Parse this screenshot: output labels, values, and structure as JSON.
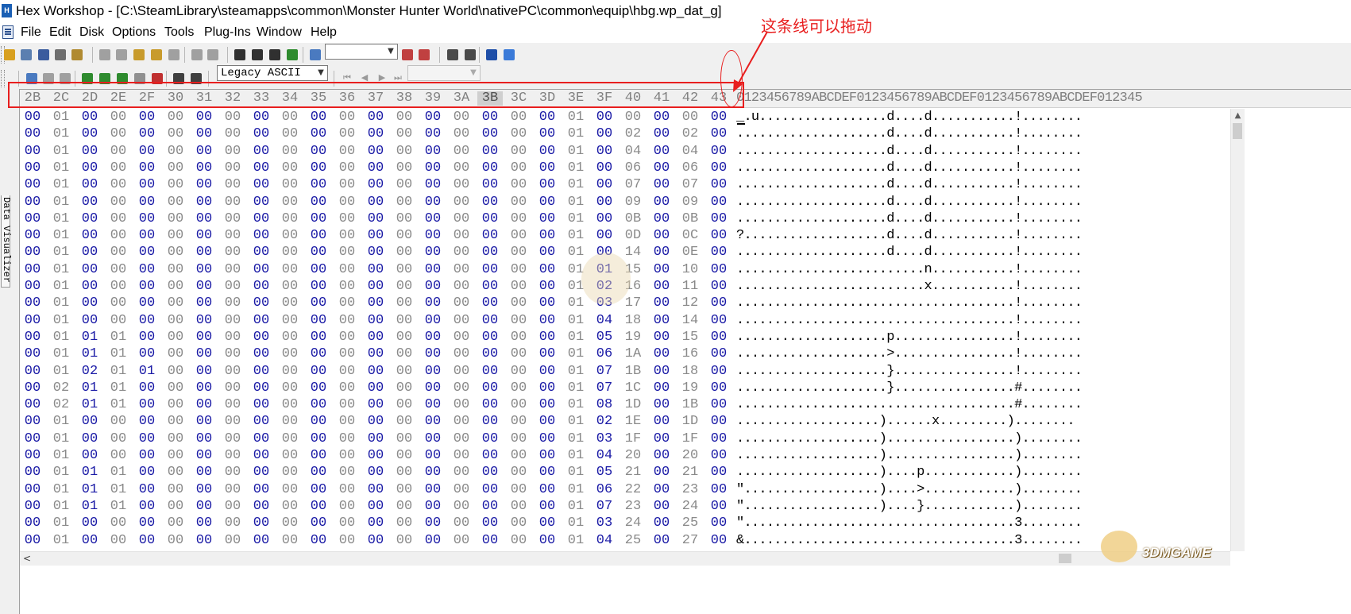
{
  "window": {
    "title": "Hex Workshop - [C:\\SteamLibrary\\steamapps\\common\\Monster Hunter World\\nativePC\\common\\equip\\hbg.wp_dat_g]"
  },
  "menu": [
    "File",
    "Edit",
    "Disk",
    "Options",
    "Tools",
    "Plug-Ins",
    "Window",
    "Help"
  ],
  "toolbar1": {
    "buttons": [
      {
        "name": "open-icon",
        "color": "#d8a020"
      },
      {
        "name": "save-all-icon",
        "color": "#5b7fb0"
      },
      {
        "name": "save-icon",
        "color": "#3b5c9e"
      },
      {
        "name": "print-icon",
        "color": "#6e6e6e"
      },
      {
        "name": "properties-icon",
        "color": "#b08a30"
      },
      {
        "name": "cut-icon",
        "color": "#a0a0a0"
      },
      {
        "name": "copy-icon",
        "color": "#a0a0a0"
      },
      {
        "name": "paste-icon",
        "color": "#c89b2c"
      },
      {
        "name": "paste-special-icon",
        "color": "#c89b2c"
      },
      {
        "name": "delete-icon",
        "color": "#a0a0a0"
      },
      {
        "name": "undo-icon",
        "color": "#a0a0a0"
      },
      {
        "name": "redo-icon",
        "color": "#a0a0a0"
      },
      {
        "name": "find-icon",
        "color": "#303030"
      },
      {
        "name": "find-prev-icon",
        "color": "#303030"
      },
      {
        "name": "find-next-icon",
        "color": "#303030"
      },
      {
        "name": "replace-icon",
        "color": "#2e8b2e"
      },
      {
        "name": "goto-icon",
        "color": "#4a7ac0"
      },
      {
        "name": "bookmark-prev-icon",
        "color": "#c04040"
      },
      {
        "name": "bookmark-next-icon",
        "color": "#c04040"
      },
      {
        "name": "hex-view-icon",
        "color": "#4a4a4a"
      },
      {
        "name": "ascii-view-icon",
        "color": "#4a4a4a"
      },
      {
        "name": "motorola-icon",
        "color": "#1f4fa8"
      },
      {
        "name": "intel-icon",
        "color": "#3a7ad8"
      }
    ],
    "goto_combo_value": ""
  },
  "toolbar2": {
    "buttons": [
      {
        "name": "compare-icon",
        "color": "#4a7ac0"
      },
      {
        "name": "sync-icon",
        "color": "#a0a0a0"
      },
      {
        "name": "resync-icon",
        "color": "#a0a0a0"
      },
      {
        "name": "checksum-icon",
        "color": "#2e8b2e"
      },
      {
        "name": "generate-icon",
        "color": "#2e8b2e"
      },
      {
        "name": "bits-icon",
        "color": "#2e8b2e"
      },
      {
        "name": "structure-icon",
        "color": "#909090"
      },
      {
        "name": "chart-icon",
        "color": "#c03030"
      },
      {
        "name": "settings-icon",
        "color": "#404040"
      },
      {
        "name": "calculator-icon",
        "color": "#404040"
      }
    ],
    "charset_value": "Legacy ASCII",
    "nav_combo_value": ""
  },
  "side_panel": {
    "label": "Data Visualizer"
  },
  "editor": {
    "header_hex": [
      "2B",
      "2C",
      "2D",
      "2E",
      "2F",
      "30",
      "31",
      "32",
      "33",
      "34",
      "35",
      "36",
      "37",
      "38",
      "39",
      "3A",
      "3B",
      "3C",
      "3D",
      "3E",
      "3F",
      "40",
      "41",
      "42",
      "43"
    ],
    "active_header": "3B",
    "header_ascii": "0123456789ABCDEF0123456789ABCDEF0123456789ABCDEF012345",
    "rows": [
      {
        "hex": [
          "00",
          "01",
          "00",
          "00",
          "00",
          "00",
          "00",
          "00",
          "00",
          "00",
          "00",
          "00",
          "00",
          "00",
          "00",
          "00",
          "00",
          "00",
          "00",
          "01",
          "00",
          "00",
          "00",
          "00",
          "00"
        ],
        "ascii": "_.u.................d....d...........!........"
      },
      {
        "hex": [
          "00",
          "01",
          "00",
          "00",
          "00",
          "00",
          "00",
          "00",
          "00",
          "00",
          "00",
          "00",
          "00",
          "00",
          "00",
          "00",
          "00",
          "00",
          "00",
          "01",
          "00",
          "02",
          "00",
          "02",
          "00"
        ],
        "ascii": "....................d....d...........!........"
      },
      {
        "hex": [
          "00",
          "01",
          "00",
          "00",
          "00",
          "00",
          "00",
          "00",
          "00",
          "00",
          "00",
          "00",
          "00",
          "00",
          "00",
          "00",
          "00",
          "00",
          "00",
          "01",
          "00",
          "04",
          "00",
          "04",
          "00"
        ],
        "ascii": "....................d....d...........!........"
      },
      {
        "hex": [
          "00",
          "01",
          "00",
          "00",
          "00",
          "00",
          "00",
          "00",
          "00",
          "00",
          "00",
          "00",
          "00",
          "00",
          "00",
          "00",
          "00",
          "00",
          "00",
          "01",
          "00",
          "06",
          "00",
          "06",
          "00"
        ],
        "ascii": "....................d....d...........!........"
      },
      {
        "hex": [
          "00",
          "01",
          "00",
          "00",
          "00",
          "00",
          "00",
          "00",
          "00",
          "00",
          "00",
          "00",
          "00",
          "00",
          "00",
          "00",
          "00",
          "00",
          "00",
          "01",
          "00",
          "07",
          "00",
          "07",
          "00"
        ],
        "ascii": "....................d....d...........!........"
      },
      {
        "hex": [
          "00",
          "01",
          "00",
          "00",
          "00",
          "00",
          "00",
          "00",
          "00",
          "00",
          "00",
          "00",
          "00",
          "00",
          "00",
          "00",
          "00",
          "00",
          "00",
          "01",
          "00",
          "09",
          "00",
          "09",
          "00"
        ],
        "ascii": "....................d....d...........!........"
      },
      {
        "hex": [
          "00",
          "01",
          "00",
          "00",
          "00",
          "00",
          "00",
          "00",
          "00",
          "00",
          "00",
          "00",
          "00",
          "00",
          "00",
          "00",
          "00",
          "00",
          "00",
          "01",
          "00",
          "0B",
          "00",
          "0B",
          "00"
        ],
        "ascii": "....................d....d...........!........"
      },
      {
        "hex": [
          "00",
          "01",
          "00",
          "00",
          "00",
          "00",
          "00",
          "00",
          "00",
          "00",
          "00",
          "00",
          "00",
          "00",
          "00",
          "00",
          "00",
          "00",
          "00",
          "01",
          "00",
          "0D",
          "00",
          "0C",
          "00"
        ],
        "ascii": "?...................d....d...........!........"
      },
      {
        "hex": [
          "00",
          "01",
          "00",
          "00",
          "00",
          "00",
          "00",
          "00",
          "00",
          "00",
          "00",
          "00",
          "00",
          "00",
          "00",
          "00",
          "00",
          "00",
          "00",
          "01",
          "00",
          "14",
          "00",
          "0E",
          "00"
        ],
        "ascii": "....................d....d...........!........"
      },
      {
        "hex": [
          "00",
          "01",
          "00",
          "00",
          "00",
          "00",
          "00",
          "00",
          "00",
          "00",
          "00",
          "00",
          "00",
          "00",
          "00",
          "00",
          "00",
          "00",
          "00",
          "01",
          "01",
          "15",
          "00",
          "10",
          "00"
        ],
        "ascii": ".........................n...........!........"
      },
      {
        "hex": [
          "00",
          "01",
          "00",
          "00",
          "00",
          "00",
          "00",
          "00",
          "00",
          "00",
          "00",
          "00",
          "00",
          "00",
          "00",
          "00",
          "00",
          "00",
          "00",
          "01",
          "02",
          "16",
          "00",
          "11",
          "00"
        ],
        "ascii": ".........................x...........!........"
      },
      {
        "hex": [
          "00",
          "01",
          "00",
          "00",
          "00",
          "00",
          "00",
          "00",
          "00",
          "00",
          "00",
          "00",
          "00",
          "00",
          "00",
          "00",
          "00",
          "00",
          "00",
          "01",
          "03",
          "17",
          "00",
          "12",
          "00"
        ],
        "ascii": ".....................................!........"
      },
      {
        "hex": [
          "00",
          "01",
          "00",
          "00",
          "00",
          "00",
          "00",
          "00",
          "00",
          "00",
          "00",
          "00",
          "00",
          "00",
          "00",
          "00",
          "00",
          "00",
          "00",
          "01",
          "04",
          "18",
          "00",
          "14",
          "00"
        ],
        "ascii": ".....................................!........"
      },
      {
        "hex": [
          "00",
          "01",
          "01",
          "01",
          "00",
          "00",
          "00",
          "00",
          "00",
          "00",
          "00",
          "00",
          "00",
          "00",
          "00",
          "00",
          "00",
          "00",
          "00",
          "01",
          "05",
          "19",
          "00",
          "15",
          "00"
        ],
        "ascii": "....................p................!........"
      },
      {
        "hex": [
          "00",
          "01",
          "01",
          "01",
          "00",
          "00",
          "00",
          "00",
          "00",
          "00",
          "00",
          "00",
          "00",
          "00",
          "00",
          "00",
          "00",
          "00",
          "00",
          "01",
          "06",
          "1A",
          "00",
          "16",
          "00"
        ],
        "ascii": "....................>................!........"
      },
      {
        "hex": [
          "00",
          "01",
          "02",
          "01",
          "01",
          "00",
          "00",
          "00",
          "00",
          "00",
          "00",
          "00",
          "00",
          "00",
          "00",
          "00",
          "00",
          "00",
          "00",
          "01",
          "07",
          "1B",
          "00",
          "18",
          "00"
        ],
        "ascii": "....................}................!........"
      },
      {
        "hex": [
          "00",
          "02",
          "01",
          "01",
          "00",
          "00",
          "00",
          "00",
          "00",
          "00",
          "00",
          "00",
          "00",
          "00",
          "00",
          "00",
          "00",
          "00",
          "00",
          "01",
          "07",
          "1C",
          "00",
          "19",
          "00"
        ],
        "ascii": "....................}................#........"
      },
      {
        "hex": [
          "00",
          "02",
          "01",
          "01",
          "00",
          "00",
          "00",
          "00",
          "00",
          "00",
          "00",
          "00",
          "00",
          "00",
          "00",
          "00",
          "00",
          "00",
          "00",
          "01",
          "08",
          "1D",
          "00",
          "1B",
          "00"
        ],
        "ascii": ".....................................#........"
      },
      {
        "hex": [
          "00",
          "01",
          "00",
          "00",
          "00",
          "00",
          "00",
          "00",
          "00",
          "00",
          "00",
          "00",
          "00",
          "00",
          "00",
          "00",
          "00",
          "00",
          "00",
          "01",
          "02",
          "1E",
          "00",
          "1D",
          "00"
        ],
        "ascii": "...................)......x.........)........"
      },
      {
        "hex": [
          "00",
          "01",
          "00",
          "00",
          "00",
          "00",
          "00",
          "00",
          "00",
          "00",
          "00",
          "00",
          "00",
          "00",
          "00",
          "00",
          "00",
          "00",
          "00",
          "01",
          "03",
          "1F",
          "00",
          "1F",
          "00"
        ],
        "ascii": "...................).................)........"
      },
      {
        "hex": [
          "00",
          "01",
          "00",
          "00",
          "00",
          "00",
          "00",
          "00",
          "00",
          "00",
          "00",
          "00",
          "00",
          "00",
          "00",
          "00",
          "00",
          "00",
          "00",
          "01",
          "04",
          "20",
          "00",
          "20",
          "00"
        ],
        "ascii": "...................).................)........"
      },
      {
        "hex": [
          "00",
          "01",
          "01",
          "01",
          "00",
          "00",
          "00",
          "00",
          "00",
          "00",
          "00",
          "00",
          "00",
          "00",
          "00",
          "00",
          "00",
          "00",
          "00",
          "01",
          "05",
          "21",
          "00",
          "21",
          "00"
        ],
        "ascii": "...................)....p............)........"
      },
      {
        "hex": [
          "00",
          "01",
          "01",
          "01",
          "00",
          "00",
          "00",
          "00",
          "00",
          "00",
          "00",
          "00",
          "00",
          "00",
          "00",
          "00",
          "00",
          "00",
          "00",
          "01",
          "06",
          "22",
          "00",
          "23",
          "00"
        ],
        "ascii": "\"..................)....>............)........"
      },
      {
        "hex": [
          "00",
          "01",
          "01",
          "01",
          "00",
          "00",
          "00",
          "00",
          "00",
          "00",
          "00",
          "00",
          "00",
          "00",
          "00",
          "00",
          "00",
          "00",
          "00",
          "01",
          "07",
          "23",
          "00",
          "24",
          "00"
        ],
        "ascii": "\"..................)....}............)........"
      },
      {
        "hex": [
          "00",
          "01",
          "00",
          "00",
          "00",
          "00",
          "00",
          "00",
          "00",
          "00",
          "00",
          "00",
          "00",
          "00",
          "00",
          "00",
          "00",
          "00",
          "00",
          "01",
          "03",
          "24",
          "00",
          "25",
          "00"
        ],
        "ascii": "\"....................................3........"
      },
      {
        "hex": [
          "00",
          "01",
          "00",
          "00",
          "00",
          "00",
          "00",
          "00",
          "00",
          "00",
          "00",
          "00",
          "00",
          "00",
          "00",
          "00",
          "00",
          "00",
          "00",
          "01",
          "04",
          "25",
          "00",
          "27",
          "00"
        ],
        "ascii": "&....................................3........"
      }
    ]
  },
  "annotation": {
    "text": "这条线可以拖动"
  },
  "watermark": {
    "text": "3DMGAME"
  },
  "colors": {
    "byte_blue": "#1a1aa6",
    "byte_gray": "#8a8a8a",
    "annotation_red": "#e81e1e"
  }
}
